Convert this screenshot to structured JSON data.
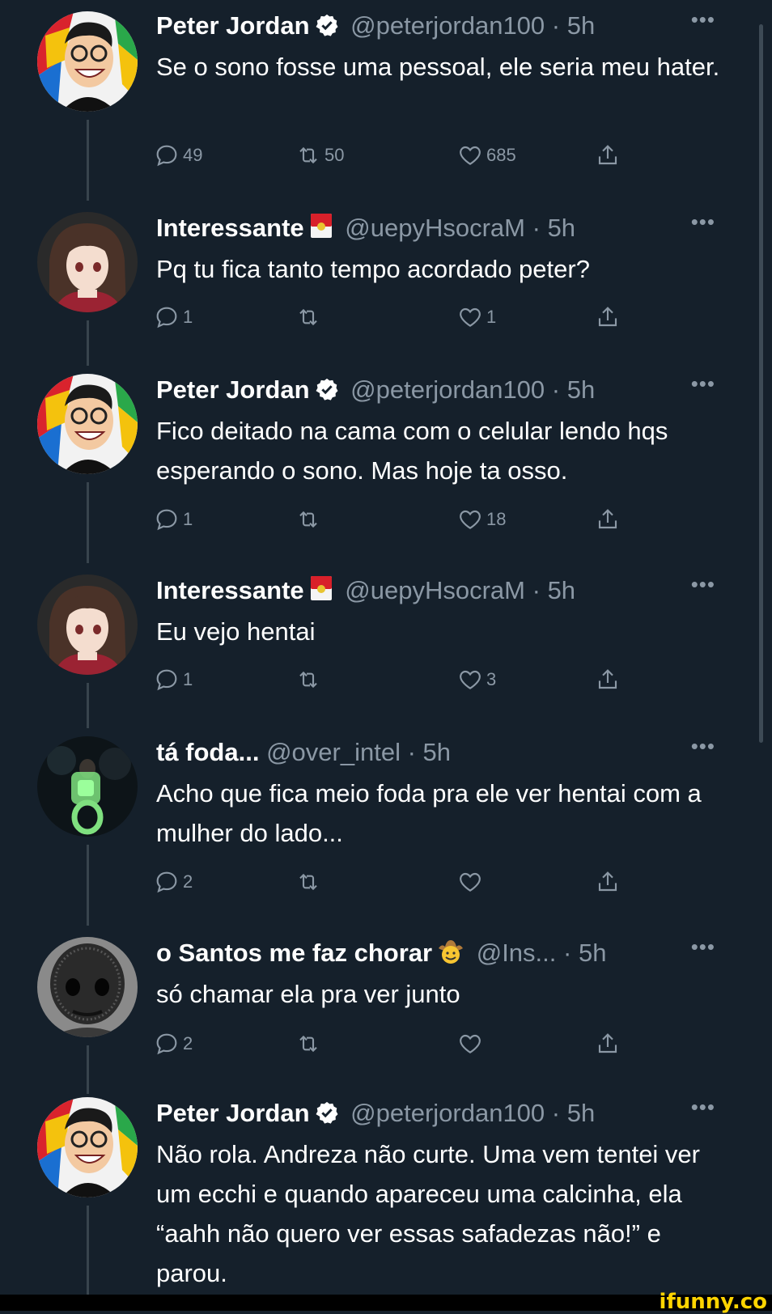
{
  "tweets": [
    {
      "name": "Peter Jordan",
      "verified": true,
      "handle": "@peterjordan100",
      "sep": "·",
      "time": "5h",
      "more": "•••",
      "text": "Se o sono fosse uma pessoal, ele seria meu hater.",
      "replies": "49",
      "retweets": "50",
      "likes": "685",
      "avatar": "cartoon-man"
    },
    {
      "name": "Interessante",
      "badge_icon": "red-envelope-icon",
      "handle": "@uepyHsocraM",
      "sep": "·",
      "time": "5h",
      "more": "•••",
      "text": "Pq tu fica tanto tempo acordado peter?",
      "replies": "1",
      "retweets": "",
      "likes": "1",
      "avatar": "anime-girl"
    },
    {
      "name": "Peter Jordan",
      "verified": true,
      "handle": "@peterjordan100",
      "sep": "·",
      "time": "5h",
      "more": "•••",
      "text": "Fico deitado na cama com o celular lendo hqs esperando o sono. Mas hoje ta osso.",
      "replies": "1",
      "retweets": "",
      "likes": "18",
      "avatar": "cartoon-man"
    },
    {
      "name": "Interessante",
      "badge_icon": "red-envelope-icon",
      "handle": "@uepyHsocraM",
      "sep": "·",
      "time": "5h",
      "more": "•••",
      "text": "Eu vejo hentai",
      "replies": "1",
      "retweets": "",
      "likes": "3",
      "avatar": "anime-girl"
    },
    {
      "name": "tá foda...",
      "handle": "@over_intel",
      "sep": "·",
      "time": "5h",
      "more": "•••",
      "text": "Acho que fica meio foda pra ele ver hentai com a mulher do lado...",
      "replies": "2",
      "retweets": "",
      "likes": "",
      "avatar": "green-toilet"
    },
    {
      "name": "o Santos me faz chorar",
      "badge_icon": "cowboy-emoji-icon",
      "handle": "@Ins...",
      "sep": "·",
      "time": "5h",
      "more": "•••",
      "text": "só chamar ela pra ver junto",
      "replies": "2",
      "retweets": "",
      "likes": "",
      "avatar": "dark-creature"
    },
    {
      "name": "Peter Jordan",
      "verified": true,
      "handle": "@peterjordan100",
      "sep": "·",
      "time": "5h",
      "more": "•••",
      "text": "Não rola. Andreza não curte. Uma vem tentei ver um ecchi e quando apareceu uma calcinha, ela “aahh não quero ver essas safadezas não!” e parou.",
      "avatar": "cartoon-man"
    }
  ],
  "watermark": "ifunny.co",
  "colors": {
    "background": "#15202b",
    "secondary_text": "#8b98a5",
    "thread_line": "#38444d",
    "verified": "#ffffff"
  }
}
